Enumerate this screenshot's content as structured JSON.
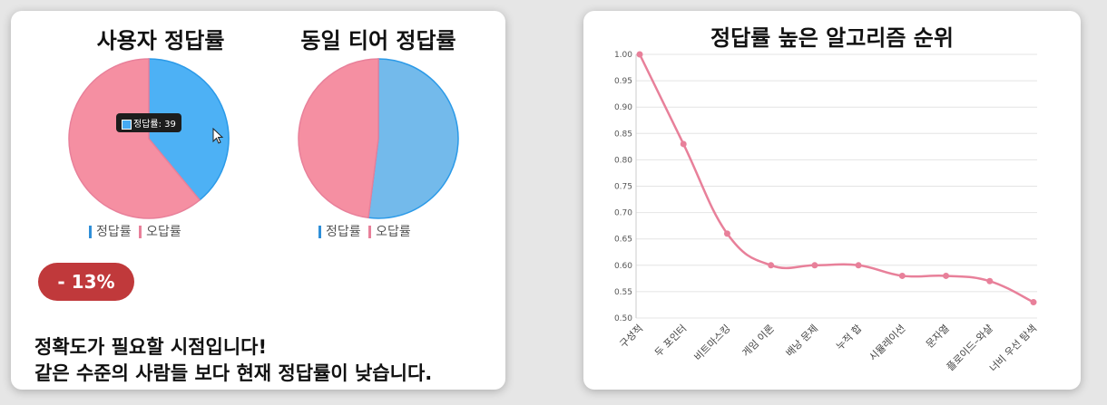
{
  "user_pie": {
    "title": "사용자 정답률",
    "legend": [
      "정답률",
      "오답률"
    ],
    "tooltip": "정답률: 39",
    "colors": {
      "correct": "#4db1f5",
      "wrong": "#f58fa2"
    }
  },
  "tier_pie": {
    "title": "동일 티어 정답률",
    "legend": [
      "정답률",
      "오답률"
    ],
    "colors": {
      "correct": "#73baeb",
      "wrong": "#f58fa2"
    }
  },
  "badge": "- 13%",
  "message": {
    "line1": "정확도가 필요할 시점입니다!",
    "line2": "같은 수준의 사람들 보다 현재 정답률이 낮습니다."
  },
  "chart_data": [
    {
      "type": "pie",
      "title": "사용자 정답률",
      "categories": [
        "정답률",
        "오답률"
      ],
      "values": [
        39,
        61
      ]
    },
    {
      "type": "pie",
      "title": "동일 티어 정답률",
      "categories": [
        "정답률",
        "오답률"
      ],
      "values": [
        52,
        48
      ]
    },
    {
      "type": "line",
      "title": "정답률 높은 알고리즘 순위",
      "categories": [
        "구성적",
        "두 포인터",
        "비트마스킹",
        "게임 이론",
        "배낭 문제",
        "누적 합",
        "시뮬레이션",
        "문자열",
        "플로이드–와샬",
        "너비 우선 탐색"
      ],
      "values": [
        1.0,
        0.83,
        0.66,
        0.6,
        0.6,
        0.6,
        0.58,
        0.58,
        0.57,
        0.53
      ],
      "ylim": [
        0.5,
        1.0
      ],
      "yticks": [
        "1.00",
        "0.95",
        "0.90",
        "0.85",
        "0.80",
        "0.75",
        "0.70",
        "0.65",
        "0.60",
        "0.55",
        "0.50"
      ],
      "grid": true,
      "color": "#e8809a"
    }
  ]
}
